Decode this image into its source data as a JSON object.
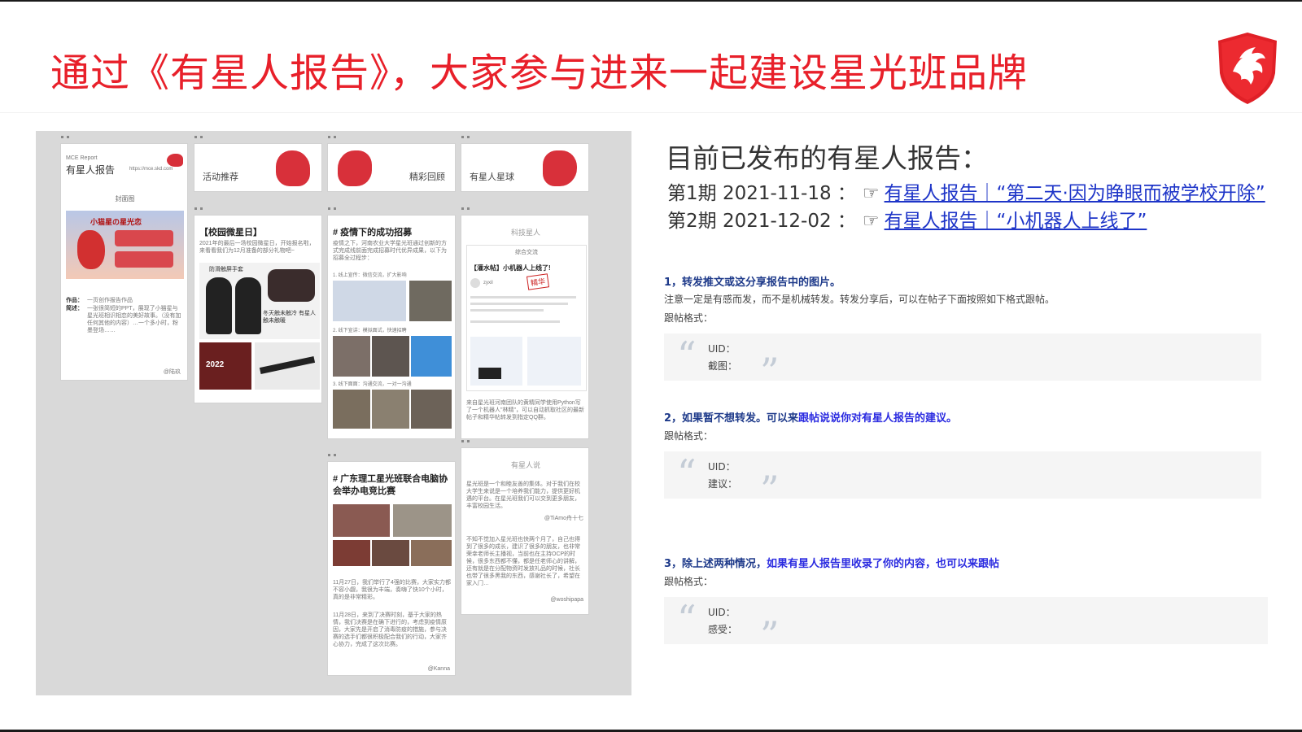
{
  "header": {
    "title": "通过《有星人报告》，大家参与进来一起建设星光班品牌"
  },
  "collage": {
    "cover": {
      "brand": "MCE Report",
      "name": "有星人报告",
      "url": "https://mce.skd.com",
      "section": "封面图",
      "poster_title": "小猫星の星光恋",
      "author_label": "作品：",
      "author_value": "一页创作报告作品",
      "desc_label": "简述：",
      "desc": "一张很简短的PPT，展现了小猫星与星光班相识相恋的美好故事。（没有加任何其他的内容）…一个多小时，粉墨登场……",
      "signature": "@陆玖"
    },
    "tiles": [
      {
        "label": "活动推荐"
      },
      {
        "label": "精彩回顾"
      },
      {
        "label": "有星人星球"
      }
    ],
    "campus": {
      "title": "【校园微星日】",
      "text": "2021年的最后一场校园微星日，开始报名啦，来看看我们为12月准备的部分礼物吧~",
      "gift1": "防滑触屏手套",
      "gift2": "冬天触未触冷 有星人触未触暖",
      "calendar": "2022"
    },
    "recruit": {
      "title": "# 疫情下的成功招募",
      "text": "疫情之下，河南农业大学星光班通过创新的方式完成线前面完成招募时代优异成果，以下为招募全过程步：",
      "step1": "1. 线上宣传：微信交流，扩大影响",
      "step2": "2. 线下宣讲：模拟面试，快速招聘",
      "step3": "3. 线下面面：沟通交流，一对一沟通"
    },
    "tech": {
      "section": "科技星人",
      "forum": "综合交流",
      "post_title": "【灌水帖】小机器人上线了!",
      "badge": "精华",
      "user": "zyxil",
      "text": "来自星光班河南团队的黄精同学使用Python写了一个机器人\"林精\"，可以自动抓取社区的最新帖子和精华帖转发到指定QQ群。"
    },
    "guangdong": {
      "title": "# 广东理工星光班联合电脑协会举办电竞比赛",
      "p1": "11月27日，我们举行了4强的比赛，大家实力都不容小觑，我很为丰端，奏嗨了快10个小时，真的是非常精彩。",
      "p2": "11月28日，来到了决赛时刻，基于大家的热情，我们决赛是在确下进行的，考虑到疫情原因，大家先是开启了消毒防疫的措施，参与决赛的选手们都很积极配合我们的行动，大家齐心协力，完成了这次比赛。",
      "signature": "@Kanna"
    },
    "voices": {
      "section": "有星人说",
      "q1": "星光班是一个和睦友善的集体。对于我们在校大学生来说是一个培养我们能力，提供更好机遇的平台。在星光班我们可以交到更多朋友，丰富校园生活。",
      "sig1": "@TiAmo舟十七",
      "q2": "不知不觉加入星光班也快两个月了，自己也得到了很多的成长，建识了很多的朋友，也非常荣幸老师长主播视，当前也在主持OCP的时候，很多东西都不懂，都是任老师心的讲解，还有就是在分配物资时发放礼品的时候，社长也带了很多黑我的东西，感谢社长了，希望在家入门…",
      "sig2": "@woshipapa"
    }
  },
  "right": {
    "heading": "目前已发布的有星人报告：",
    "issues": [
      {
        "label": "第1期 2021-11-18 ：",
        "link": "有星人报告｜“第二天·因为睁眼而被学校开除”"
      },
      {
        "label": "第2期 2021-12-02 ：",
        "link": "有星人报告｜“小机器人上线了”"
      }
    ],
    "steps": [
      {
        "title_a": "1，转发推文或这分享报告中的图片。",
        "title_b": "",
        "note": "注意一定是有感而发，而不是机械转发。转发分享后，可以在帖子下面按照如下格式跟帖。",
        "format_label": "跟帖格式：",
        "f1": "UID：",
        "f2": "截图："
      },
      {
        "title_a": "2，如果暂不想转发。可以来",
        "title_b": "跟帖说说你对有星人报告的建议。",
        "note": "",
        "format_label": "跟帖格式：",
        "f1": "UID：",
        "f2": "建议："
      },
      {
        "title_a": "3，除上述两种情况，",
        "title_b": "如果有星人报告里收录了你的内容，也可以来跟帖",
        "note": "",
        "format_label": "跟帖格式：",
        "f1": "UID：",
        "f2": "感受："
      }
    ],
    "open_quote": "“",
    "close_quote": "”"
  },
  "colors": {
    "title_red": "#e8202a",
    "link_blue": "#1e35c8",
    "step_blue": "#1e3a8a"
  }
}
